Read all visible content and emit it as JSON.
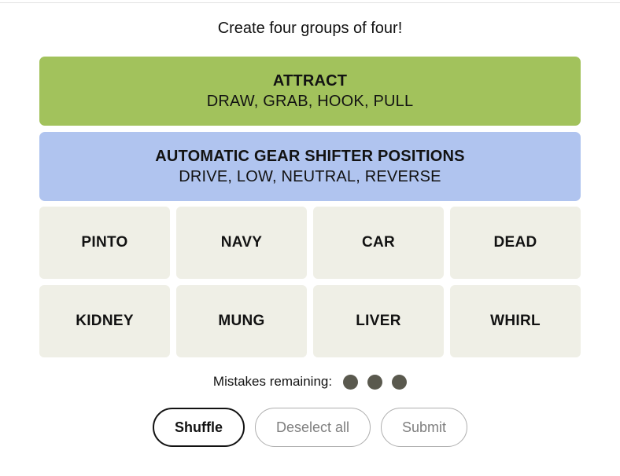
{
  "page": {
    "title": "Create four groups of four!"
  },
  "solved_groups": [
    {
      "title": "ATTRACT",
      "members": "DRAW, GRAB, HOOK, PULL",
      "color": "#a2c25c"
    },
    {
      "title": "AUTOMATIC GEAR SHIFTER POSITIONS",
      "members": "DRIVE, LOW, NEUTRAL, REVERSE",
      "color": "#b0c4ef"
    }
  ],
  "word_tiles": [
    {
      "label": "PINTO"
    },
    {
      "label": "NAVY"
    },
    {
      "label": "CAR"
    },
    {
      "label": "DEAD"
    },
    {
      "label": "KIDNEY"
    },
    {
      "label": "MUNG"
    },
    {
      "label": "LIVER"
    },
    {
      "label": "WHIRL"
    }
  ],
  "mistakes": {
    "label": "Mistakes remaining:",
    "remaining": 3,
    "dot_color": "#5a594e"
  },
  "buttons": [
    {
      "label": "Shuffle",
      "state": "enabled"
    },
    {
      "label": "Deselect all",
      "state": "disabled"
    },
    {
      "label": "Submit",
      "state": "disabled"
    }
  ],
  "theme": {
    "background": "#ffffff",
    "tile_background": "#efefe6",
    "text_color": "#121212",
    "disabled_color": "#7f7f7f",
    "rule_color": "#e2e2e2"
  }
}
